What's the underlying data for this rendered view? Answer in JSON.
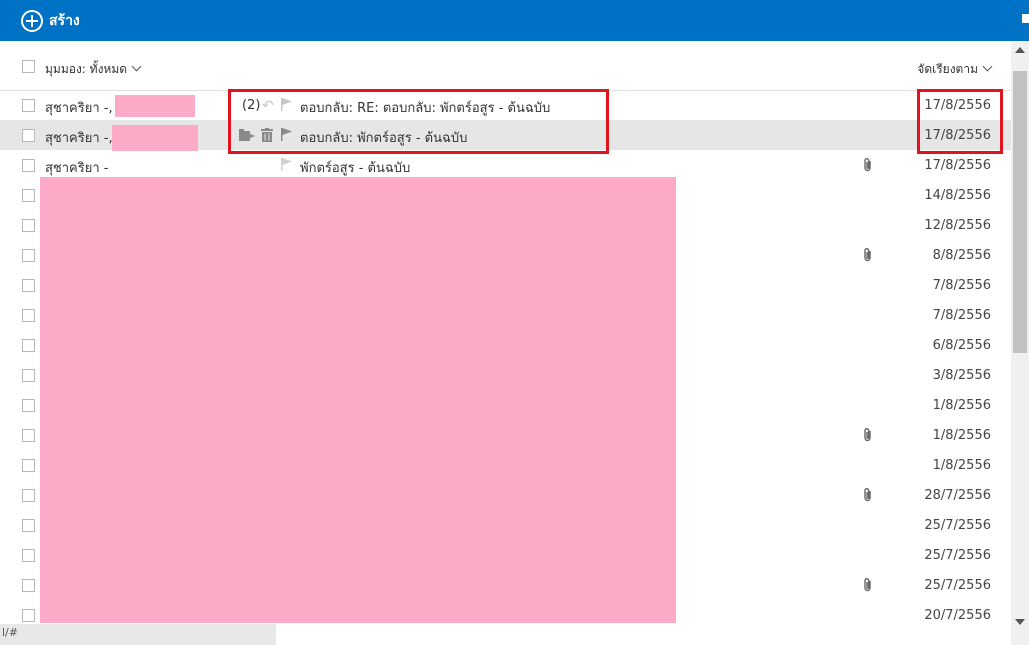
{
  "toolbar": {
    "new_label": "สร้าง"
  },
  "header": {
    "view_label": "มุมมอง: ทั้งหมด",
    "sort_label": "จัดเรียงตาม"
  },
  "rows": [
    {
      "sender": "สุชาคริยา -,",
      "count": "(2)",
      "subject": "ตอบกลับ: RE: ตอบกลับ: พักตร์อสูร - ต้นฉบับ",
      "date": "17/8/2556",
      "attachment": false
    },
    {
      "sender": "สุชาคริยา -,",
      "subject": "ตอบกลับ: พักตร์อสูร - ต้นฉบับ",
      "date": "17/8/2556",
      "attachment": false,
      "selected": true
    },
    {
      "sender": "สุชาคริยา -",
      "subject": "พักตร์อสูร - ต้นฉบับ",
      "date": "17/8/2556",
      "attachment": true
    },
    {
      "sender": "",
      "subject": "",
      "date": "14/8/2556",
      "attachment": false
    },
    {
      "sender": "",
      "subject": "",
      "date": "12/8/2556",
      "attachment": false
    },
    {
      "sender": "",
      "subject": "",
      "date": "8/8/2556",
      "attachment": true
    },
    {
      "sender": "",
      "subject": "",
      "date": "7/8/2556",
      "attachment": false
    },
    {
      "sender": "",
      "subject": "",
      "date": "7/8/2556",
      "attachment": false
    },
    {
      "sender": "",
      "subject": "",
      "date": "6/8/2556",
      "attachment": false
    },
    {
      "sender": "",
      "subject": "",
      "date": "3/8/2556",
      "attachment": false
    },
    {
      "sender": "",
      "subject": "",
      "date": "1/8/2556",
      "attachment": false
    },
    {
      "sender": "",
      "subject": "",
      "date": "1/8/2556",
      "attachment": true
    },
    {
      "sender": "",
      "subject": "",
      "date": "1/8/2556",
      "attachment": false
    },
    {
      "sender": "",
      "subject": "",
      "date": "28/7/2556",
      "attachment": true
    },
    {
      "sender": "",
      "subject": "",
      "date": "25/7/2556",
      "attachment": false
    },
    {
      "sender": "",
      "subject": "",
      "date": "25/7/2556",
      "attachment": false
    },
    {
      "sender": "",
      "subject": "",
      "date": "25/7/2556",
      "attachment": true
    },
    {
      "sender": "",
      "subject": "",
      "date": "20/7/2556",
      "attachment": false
    }
  ],
  "status": {
    "url_fragment": "l/#"
  },
  "colors": {
    "topbar": "#0072c6",
    "redaction": "#fcaac8",
    "highlight_box": "#e0141e"
  }
}
